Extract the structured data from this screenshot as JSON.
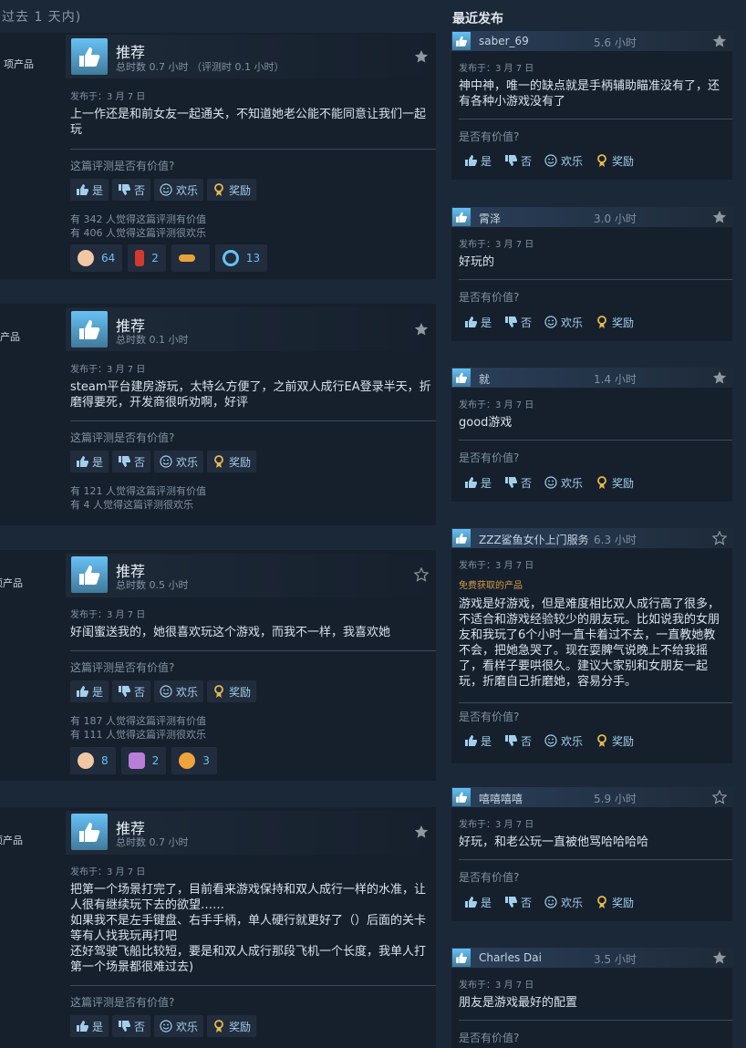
{
  "header": {
    "left_title": "过去 1 天内)",
    "right_title": "最近发布"
  },
  "common": {
    "posted": "发布于：3 月 7 日",
    "helpful_question": "这篇评测是否有价值?",
    "right_helpful_question": "是否有价值?",
    "yes": "是",
    "no": "否",
    "funny": "欢乐",
    "award": "奖励"
  },
  "colors": {
    "background": "#1b2838",
    "card": "#16202d",
    "accent_blue": "#67c1f5",
    "free_label": "#d59a47"
  },
  "left_reviews": [
    {
      "side_label": "项产品",
      "title": "推荐",
      "hours": "总时数 0.7 小时 （评测时 0.1 小时）",
      "text": "上一作还是和前女友一起通关，不知道她老公能不能同意让我们一起玩",
      "helpful_count": "有 342 人觉得这篇评测有价值",
      "funny_count": "有 406 人觉得这篇评测很欢乐",
      "awards": [
        {
          "icon": "laughing-face-icon",
          "count": "64"
        },
        {
          "icon": "fire-extinguisher-icon",
          "count": "2"
        },
        {
          "icon": "pointing-hand-icon",
          "count": ""
        },
        {
          "icon": "ribbon-medal-icon",
          "count": "13"
        }
      ]
    },
    {
      "side_label": "产品",
      "title": "推荐",
      "hours": "总时数 0.1 小时",
      "text": "steam平台建房游玩，太特么方便了，之前双人成行EA登录半天，折磨得要死，开发商很听劝啊，好评",
      "helpful_count": "有 121 人觉得这篇评测有价值",
      "funny_count": "有 4 人觉得这篇评测很欢乐",
      "awards": []
    },
    {
      "side_label": "项产品",
      "title": "推荐",
      "hours": "总时数 0.5 小时",
      "text": "好闺蜜送我的，她很喜欢玩这个游戏，而我不一样，我喜欢她",
      "helpful_count": "有 187 人觉得这篇评测有价值",
      "funny_count": "有 111 人觉得这篇评测很欢乐",
      "awards": [
        {
          "icon": "laughing-face-icon",
          "count": "8"
        },
        {
          "icon": "heart-hands-icon",
          "count": "2"
        },
        {
          "icon": "shocked-face-icon",
          "count": "3"
        }
      ]
    },
    {
      "side_label": "项产品",
      "title": "推荐",
      "hours": "总时数 0.7 小时",
      "text": "把第一个场景打完了，目前看来游戏保持和双人成行一样的水准，让人很有继续玩下去的欲望……\n如果我不是左手键盘、右手手柄，单人硬行就更好了（）后面的关卡等有人找我玩再打吧\n还好驾驶飞船比较短，要是和双人成行那段飞机一个长度，我单人打第一个场景都很难过去)",
      "helpful_count": "",
      "funny_count": "",
      "awards": []
    }
  ],
  "right_reviews": [
    {
      "name": "saber_69",
      "hours": "5.6 小时",
      "text": "神中神，唯一的缺点就是手柄辅助瞄准没有了，还有各种小游戏没有了",
      "free": ""
    },
    {
      "name": "霄泽",
      "hours": "3.0 小时",
      "text": "好玩的",
      "free": ""
    },
    {
      "name": "就",
      "hours": "1.4 小时",
      "text": "good游戏",
      "free": ""
    },
    {
      "name": "ZZZ鲨鱼女仆上门服务",
      "hours": "6.3 小时",
      "text": "游戏是好游戏，但是难度相比双人成行高了很多，不适合和游戏经验较少的朋友玩。比如说我的女朋友和我玩了6个小时一直卡着过不去，一直教她教不会，把她急哭了。现在耍脾气说晚上不给我摇了，看样子要哄很久。建议大家别和女朋友一起玩，折磨自己折磨她，容易分手。",
      "free": "免费获取的产品"
    },
    {
      "name": "嘻嘻嘻嘻",
      "hours": "5.9 小时",
      "text": "好玩，和老公玩一直被他骂哈哈哈哈",
      "free": ""
    },
    {
      "name": "Charles Dai",
      "hours": "3.5 小时",
      "text": "朋友是游戏最好的配置",
      "free": ""
    }
  ]
}
